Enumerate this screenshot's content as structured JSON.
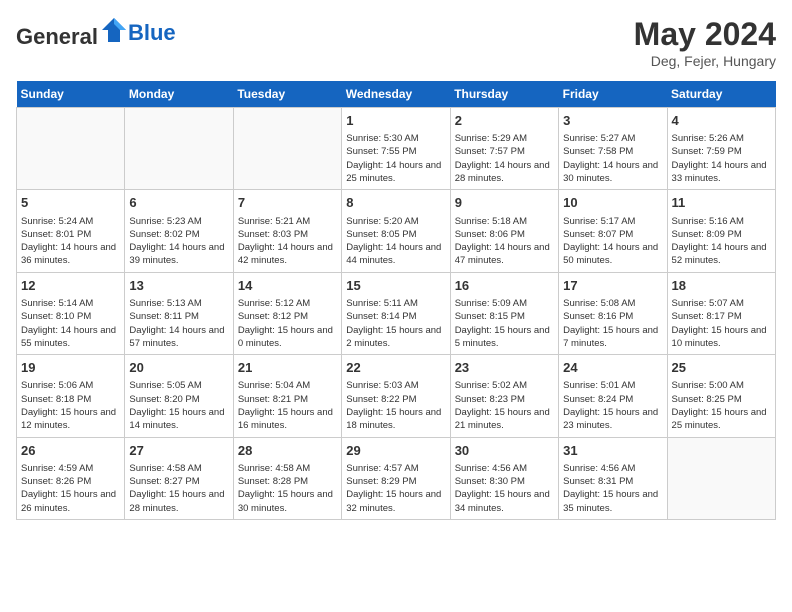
{
  "header": {
    "logo_general": "General",
    "logo_blue": "Blue",
    "month_year": "May 2024",
    "location": "Deg, Fejer, Hungary"
  },
  "days_of_week": [
    "Sunday",
    "Monday",
    "Tuesday",
    "Wednesday",
    "Thursday",
    "Friday",
    "Saturday"
  ],
  "weeks": [
    [
      {
        "day": "",
        "info": ""
      },
      {
        "day": "",
        "info": ""
      },
      {
        "day": "",
        "info": ""
      },
      {
        "day": "1",
        "info": "Sunrise: 5:30 AM\nSunset: 7:55 PM\nDaylight: 14 hours and 25 minutes."
      },
      {
        "day": "2",
        "info": "Sunrise: 5:29 AM\nSunset: 7:57 PM\nDaylight: 14 hours and 28 minutes."
      },
      {
        "day": "3",
        "info": "Sunrise: 5:27 AM\nSunset: 7:58 PM\nDaylight: 14 hours and 30 minutes."
      },
      {
        "day": "4",
        "info": "Sunrise: 5:26 AM\nSunset: 7:59 PM\nDaylight: 14 hours and 33 minutes."
      }
    ],
    [
      {
        "day": "5",
        "info": "Sunrise: 5:24 AM\nSunset: 8:01 PM\nDaylight: 14 hours and 36 minutes."
      },
      {
        "day": "6",
        "info": "Sunrise: 5:23 AM\nSunset: 8:02 PM\nDaylight: 14 hours and 39 minutes."
      },
      {
        "day": "7",
        "info": "Sunrise: 5:21 AM\nSunset: 8:03 PM\nDaylight: 14 hours and 42 minutes."
      },
      {
        "day": "8",
        "info": "Sunrise: 5:20 AM\nSunset: 8:05 PM\nDaylight: 14 hours and 44 minutes."
      },
      {
        "day": "9",
        "info": "Sunrise: 5:18 AM\nSunset: 8:06 PM\nDaylight: 14 hours and 47 minutes."
      },
      {
        "day": "10",
        "info": "Sunrise: 5:17 AM\nSunset: 8:07 PM\nDaylight: 14 hours and 50 minutes."
      },
      {
        "day": "11",
        "info": "Sunrise: 5:16 AM\nSunset: 8:09 PM\nDaylight: 14 hours and 52 minutes."
      }
    ],
    [
      {
        "day": "12",
        "info": "Sunrise: 5:14 AM\nSunset: 8:10 PM\nDaylight: 14 hours and 55 minutes."
      },
      {
        "day": "13",
        "info": "Sunrise: 5:13 AM\nSunset: 8:11 PM\nDaylight: 14 hours and 57 minutes."
      },
      {
        "day": "14",
        "info": "Sunrise: 5:12 AM\nSunset: 8:12 PM\nDaylight: 15 hours and 0 minutes."
      },
      {
        "day": "15",
        "info": "Sunrise: 5:11 AM\nSunset: 8:14 PM\nDaylight: 15 hours and 2 minutes."
      },
      {
        "day": "16",
        "info": "Sunrise: 5:09 AM\nSunset: 8:15 PM\nDaylight: 15 hours and 5 minutes."
      },
      {
        "day": "17",
        "info": "Sunrise: 5:08 AM\nSunset: 8:16 PM\nDaylight: 15 hours and 7 minutes."
      },
      {
        "day": "18",
        "info": "Sunrise: 5:07 AM\nSunset: 8:17 PM\nDaylight: 15 hours and 10 minutes."
      }
    ],
    [
      {
        "day": "19",
        "info": "Sunrise: 5:06 AM\nSunset: 8:18 PM\nDaylight: 15 hours and 12 minutes."
      },
      {
        "day": "20",
        "info": "Sunrise: 5:05 AM\nSunset: 8:20 PM\nDaylight: 15 hours and 14 minutes."
      },
      {
        "day": "21",
        "info": "Sunrise: 5:04 AM\nSunset: 8:21 PM\nDaylight: 15 hours and 16 minutes."
      },
      {
        "day": "22",
        "info": "Sunrise: 5:03 AM\nSunset: 8:22 PM\nDaylight: 15 hours and 18 minutes."
      },
      {
        "day": "23",
        "info": "Sunrise: 5:02 AM\nSunset: 8:23 PM\nDaylight: 15 hours and 21 minutes."
      },
      {
        "day": "24",
        "info": "Sunrise: 5:01 AM\nSunset: 8:24 PM\nDaylight: 15 hours and 23 minutes."
      },
      {
        "day": "25",
        "info": "Sunrise: 5:00 AM\nSunset: 8:25 PM\nDaylight: 15 hours and 25 minutes."
      }
    ],
    [
      {
        "day": "26",
        "info": "Sunrise: 4:59 AM\nSunset: 8:26 PM\nDaylight: 15 hours and 26 minutes."
      },
      {
        "day": "27",
        "info": "Sunrise: 4:58 AM\nSunset: 8:27 PM\nDaylight: 15 hours and 28 minutes."
      },
      {
        "day": "28",
        "info": "Sunrise: 4:58 AM\nSunset: 8:28 PM\nDaylight: 15 hours and 30 minutes."
      },
      {
        "day": "29",
        "info": "Sunrise: 4:57 AM\nSunset: 8:29 PM\nDaylight: 15 hours and 32 minutes."
      },
      {
        "day": "30",
        "info": "Sunrise: 4:56 AM\nSunset: 8:30 PM\nDaylight: 15 hours and 34 minutes."
      },
      {
        "day": "31",
        "info": "Sunrise: 4:56 AM\nSunset: 8:31 PM\nDaylight: 15 hours and 35 minutes."
      },
      {
        "day": "",
        "info": ""
      }
    ]
  ]
}
